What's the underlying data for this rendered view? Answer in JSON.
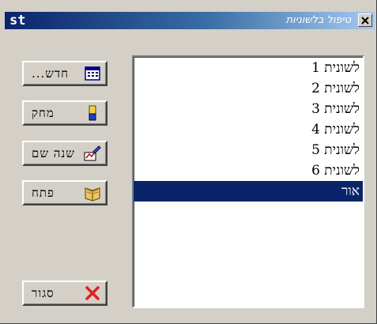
{
  "window": {
    "app_label": "st",
    "title": "טיפול בלשוניות"
  },
  "buttons": {
    "new": "חדש...",
    "delete": "מחק",
    "rename": "שנה שם",
    "open": "פתח",
    "close": "סגור"
  },
  "list": {
    "items": [
      "לשונית 1",
      "לשונית 2",
      "לשונית 3",
      "לשונית 4",
      "לשונית 5",
      "לשונית 6",
      "אור"
    ],
    "selected_index": 6
  },
  "colors": {
    "selection": "#0a246a",
    "title_start": "#0a246a",
    "title_end": "#a6caf0",
    "close_x": "#e02020"
  }
}
